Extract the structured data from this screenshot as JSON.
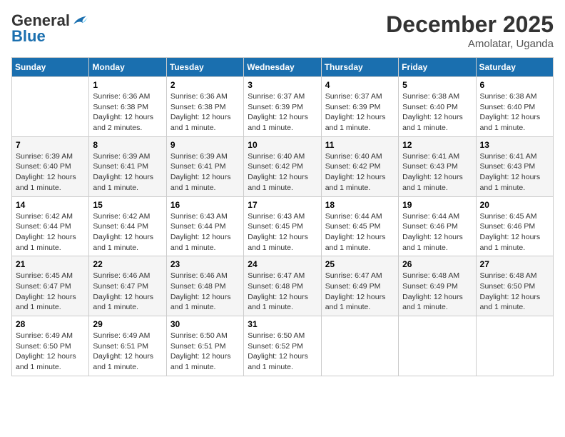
{
  "header": {
    "logo_general": "General",
    "logo_blue": "Blue",
    "month_title": "December 2025",
    "location": "Amolatar, Uganda"
  },
  "calendar": {
    "weekdays": [
      "Sunday",
      "Monday",
      "Tuesday",
      "Wednesday",
      "Thursday",
      "Friday",
      "Saturday"
    ],
    "weeks": [
      [
        {
          "day": "",
          "sunrise": "",
          "sunset": "",
          "daylight": ""
        },
        {
          "day": "1",
          "sunrise": "Sunrise: 6:36 AM",
          "sunset": "Sunset: 6:38 PM",
          "daylight": "Daylight: 12 hours and 2 minutes."
        },
        {
          "day": "2",
          "sunrise": "Sunrise: 6:36 AM",
          "sunset": "Sunset: 6:38 PM",
          "daylight": "Daylight: 12 hours and 1 minute."
        },
        {
          "day": "3",
          "sunrise": "Sunrise: 6:37 AM",
          "sunset": "Sunset: 6:39 PM",
          "daylight": "Daylight: 12 hours and 1 minute."
        },
        {
          "day": "4",
          "sunrise": "Sunrise: 6:37 AM",
          "sunset": "Sunset: 6:39 PM",
          "daylight": "Daylight: 12 hours and 1 minute."
        },
        {
          "day": "5",
          "sunrise": "Sunrise: 6:38 AM",
          "sunset": "Sunset: 6:40 PM",
          "daylight": "Daylight: 12 hours and 1 minute."
        },
        {
          "day": "6",
          "sunrise": "Sunrise: 6:38 AM",
          "sunset": "Sunset: 6:40 PM",
          "daylight": "Daylight: 12 hours and 1 minute."
        }
      ],
      [
        {
          "day": "7",
          "sunrise": "Sunrise: 6:39 AM",
          "sunset": "Sunset: 6:40 PM",
          "daylight": "Daylight: 12 hours and 1 minute."
        },
        {
          "day": "8",
          "sunrise": "Sunrise: 6:39 AM",
          "sunset": "Sunset: 6:41 PM",
          "daylight": "Daylight: 12 hours and 1 minute."
        },
        {
          "day": "9",
          "sunrise": "Sunrise: 6:39 AM",
          "sunset": "Sunset: 6:41 PM",
          "daylight": "Daylight: 12 hours and 1 minute."
        },
        {
          "day": "10",
          "sunrise": "Sunrise: 6:40 AM",
          "sunset": "Sunset: 6:42 PM",
          "daylight": "Daylight: 12 hours and 1 minute."
        },
        {
          "day": "11",
          "sunrise": "Sunrise: 6:40 AM",
          "sunset": "Sunset: 6:42 PM",
          "daylight": "Daylight: 12 hours and 1 minute."
        },
        {
          "day": "12",
          "sunrise": "Sunrise: 6:41 AM",
          "sunset": "Sunset: 6:43 PM",
          "daylight": "Daylight: 12 hours and 1 minute."
        },
        {
          "day": "13",
          "sunrise": "Sunrise: 6:41 AM",
          "sunset": "Sunset: 6:43 PM",
          "daylight": "Daylight: 12 hours and 1 minute."
        }
      ],
      [
        {
          "day": "14",
          "sunrise": "Sunrise: 6:42 AM",
          "sunset": "Sunset: 6:44 PM",
          "daylight": "Daylight: 12 hours and 1 minute."
        },
        {
          "day": "15",
          "sunrise": "Sunrise: 6:42 AM",
          "sunset": "Sunset: 6:44 PM",
          "daylight": "Daylight: 12 hours and 1 minute."
        },
        {
          "day": "16",
          "sunrise": "Sunrise: 6:43 AM",
          "sunset": "Sunset: 6:44 PM",
          "daylight": "Daylight: 12 hours and 1 minute."
        },
        {
          "day": "17",
          "sunrise": "Sunrise: 6:43 AM",
          "sunset": "Sunset: 6:45 PM",
          "daylight": "Daylight: 12 hours and 1 minute."
        },
        {
          "day": "18",
          "sunrise": "Sunrise: 6:44 AM",
          "sunset": "Sunset: 6:45 PM",
          "daylight": "Daylight: 12 hours and 1 minute."
        },
        {
          "day": "19",
          "sunrise": "Sunrise: 6:44 AM",
          "sunset": "Sunset: 6:46 PM",
          "daylight": "Daylight: 12 hours and 1 minute."
        },
        {
          "day": "20",
          "sunrise": "Sunrise: 6:45 AM",
          "sunset": "Sunset: 6:46 PM",
          "daylight": "Daylight: 12 hours and 1 minute."
        }
      ],
      [
        {
          "day": "21",
          "sunrise": "Sunrise: 6:45 AM",
          "sunset": "Sunset: 6:47 PM",
          "daylight": "Daylight: 12 hours and 1 minute."
        },
        {
          "day": "22",
          "sunrise": "Sunrise: 6:46 AM",
          "sunset": "Sunset: 6:47 PM",
          "daylight": "Daylight: 12 hours and 1 minute."
        },
        {
          "day": "23",
          "sunrise": "Sunrise: 6:46 AM",
          "sunset": "Sunset: 6:48 PM",
          "daylight": "Daylight: 12 hours and 1 minute."
        },
        {
          "day": "24",
          "sunrise": "Sunrise: 6:47 AM",
          "sunset": "Sunset: 6:48 PM",
          "daylight": "Daylight: 12 hours and 1 minute."
        },
        {
          "day": "25",
          "sunrise": "Sunrise: 6:47 AM",
          "sunset": "Sunset: 6:49 PM",
          "daylight": "Daylight: 12 hours and 1 minute."
        },
        {
          "day": "26",
          "sunrise": "Sunrise: 6:48 AM",
          "sunset": "Sunset: 6:49 PM",
          "daylight": "Daylight: 12 hours and 1 minute."
        },
        {
          "day": "27",
          "sunrise": "Sunrise: 6:48 AM",
          "sunset": "Sunset: 6:50 PM",
          "daylight": "Daylight: 12 hours and 1 minute."
        }
      ],
      [
        {
          "day": "28",
          "sunrise": "Sunrise: 6:49 AM",
          "sunset": "Sunset: 6:50 PM",
          "daylight": "Daylight: 12 hours and 1 minute."
        },
        {
          "day": "29",
          "sunrise": "Sunrise: 6:49 AM",
          "sunset": "Sunset: 6:51 PM",
          "daylight": "Daylight: 12 hours and 1 minute."
        },
        {
          "day": "30",
          "sunrise": "Sunrise: 6:50 AM",
          "sunset": "Sunset: 6:51 PM",
          "daylight": "Daylight: 12 hours and 1 minute."
        },
        {
          "day": "31",
          "sunrise": "Sunrise: 6:50 AM",
          "sunset": "Sunset: 6:52 PM",
          "daylight": "Daylight: 12 hours and 1 minute."
        },
        {
          "day": "",
          "sunrise": "",
          "sunset": "",
          "daylight": ""
        },
        {
          "day": "",
          "sunrise": "",
          "sunset": "",
          "daylight": ""
        },
        {
          "day": "",
          "sunrise": "",
          "sunset": "",
          "daylight": ""
        }
      ]
    ]
  }
}
